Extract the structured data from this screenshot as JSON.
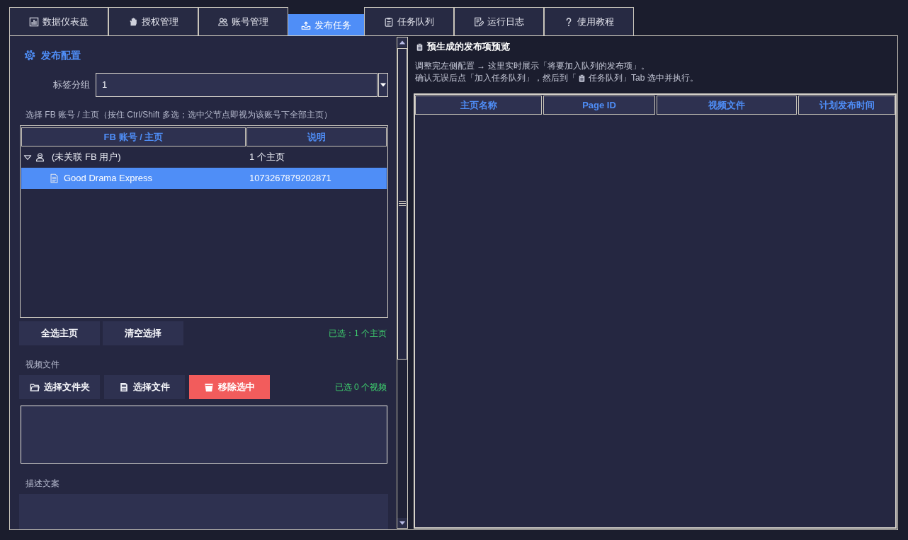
{
  "tabs": [
    {
      "label": "数据仪表盘",
      "selected": false
    },
    {
      "label": "授权管理",
      "selected": false
    },
    {
      "label": "账号管理",
      "selected": false
    },
    {
      "label": "发布任务",
      "selected": true
    },
    {
      "label": "任务队列",
      "selected": false
    },
    {
      "label": "运行日志",
      "selected": false
    },
    {
      "label": "使用教程",
      "selected": false
    }
  ],
  "publish_config": {
    "title": "发布配置",
    "tag_group": {
      "label": "标签分组",
      "value": "1"
    },
    "account_hint": "选择 FB 账号 / 主页（按住 Ctrl/Shift 多选；选中父节点即视为该账号下全部主页）",
    "account_tree": {
      "columns": [
        "FB 账号 / 主页",
        "说明"
      ],
      "items": [
        {
          "label": "(未关联 FB 用户)",
          "note": "1 个主页",
          "expanded": true,
          "selected": false,
          "children": [
            {
              "label": "Good Drama Express",
              "note": "1073267879202871",
              "selected": true
            }
          ]
        }
      ]
    },
    "page_buttons": [
      {
        "label": "全选主页"
      },
      {
        "label": "清空选择"
      }
    ],
    "page_selection_status": "已选：1 个主页",
    "video_files": {
      "label": "视频文件",
      "buttons": [
        {
          "label": "选择文件夹",
          "kind": "default"
        },
        {
          "label": "选择文件",
          "kind": "default"
        },
        {
          "label": "移除选中",
          "kind": "danger"
        }
      ],
      "status": "已选 0 个视频"
    },
    "description": {
      "label": "描述文案"
    }
  },
  "preview": {
    "title": "预生成的发布项预览",
    "hint_line_1": "调整完左侧配置 → 这里实时展示「将要加入队列的发布项」。",
    "hint_line_2_before_icon": "确认无误后点「加入任务队列」，然后到「",
    "hint_line_2_after_icon": "任务队列」Tab 选中并执行。",
    "table": {
      "columns": [
        "主页名称",
        "Page ID",
        "视频文件",
        "计划发布时间"
      ]
    }
  }
}
